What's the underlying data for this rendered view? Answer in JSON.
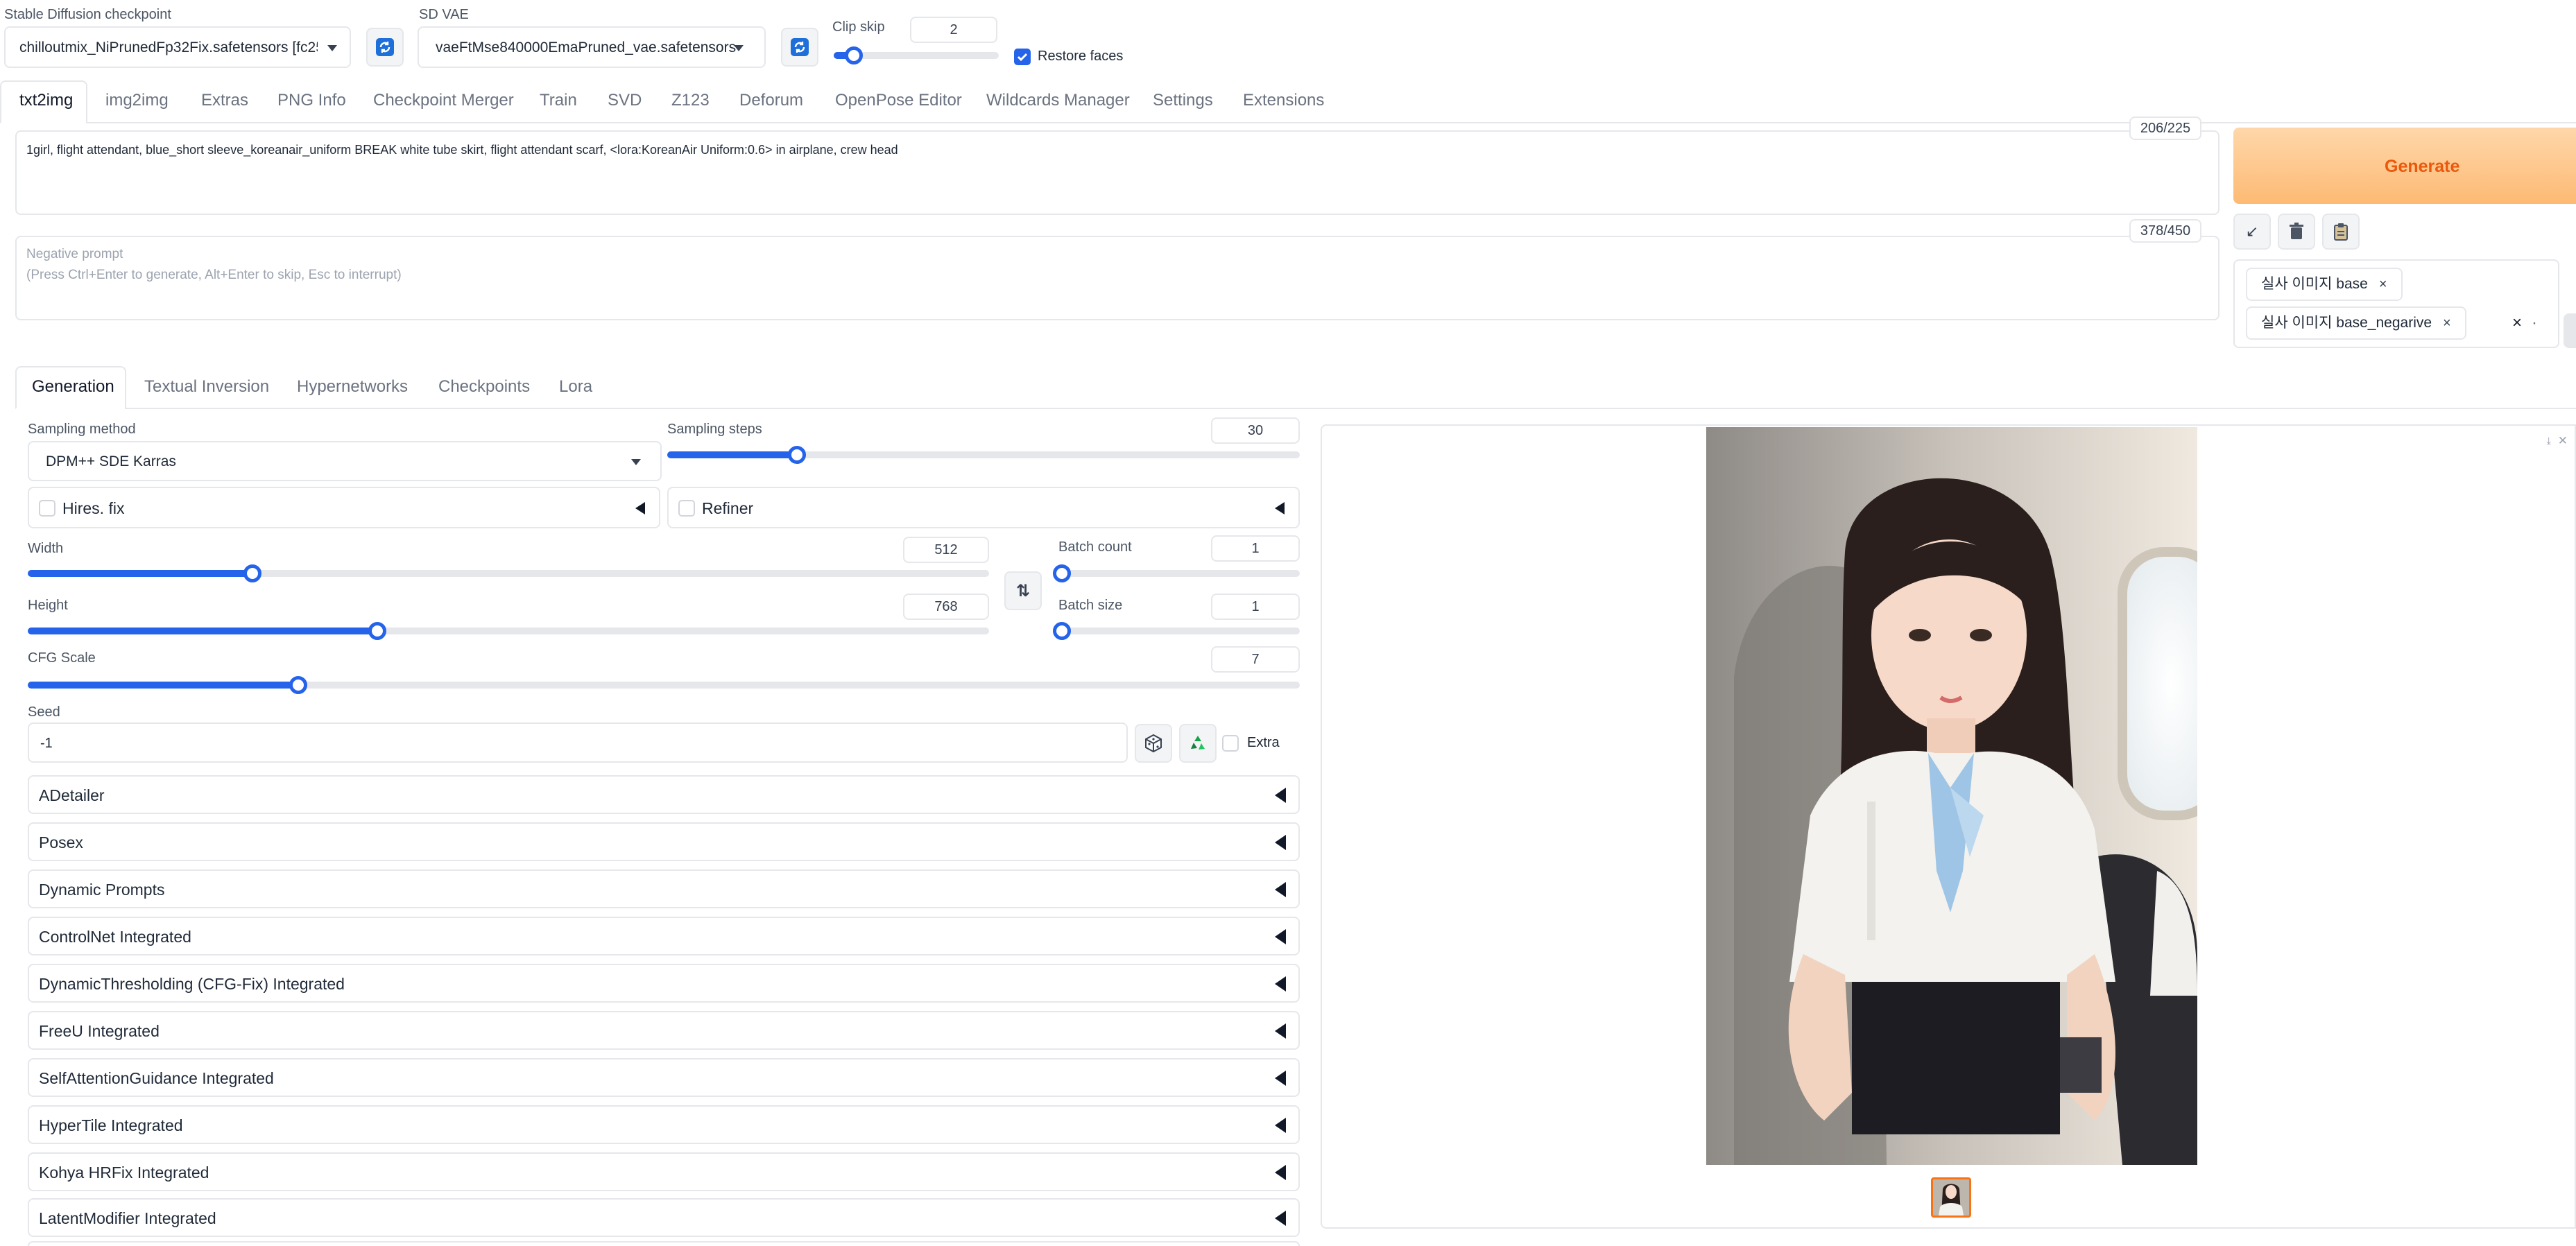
{
  "header": {
    "checkpoint_label": "Stable Diffusion checkpoint",
    "checkpoint_value": "chilloutmix_NiPrunedFp32Fix.safetensors [fc25",
    "vae_label": "SD VAE",
    "vae_value": "vaeFtMse840000EmaPruned_vae.safetensors",
    "clip_skip_label": "Clip skip",
    "clip_skip_value": "2",
    "clip_skip_fraction": 0.1,
    "restore_faces_label": "Restore faces",
    "restore_faces_checked": true
  },
  "main_tabs": [
    "txt2img",
    "img2img",
    "Extras",
    "PNG Info",
    "Checkpoint Merger",
    "Train",
    "SVD",
    "Z123",
    "Deforum",
    "OpenPose Editor",
    "Wildcards Manager",
    "Settings",
    "Extensions"
  ],
  "prompt": {
    "text": "1girl, flight attendant, blue_short sleeve_koreanair_uniform BREAK white tube skirt, flight attendant scarf, <lora:KoreanAir Uniform:0.6> in airplane, crew head",
    "counter": "206/225"
  },
  "negative": {
    "placeholder_line1": "Negative prompt",
    "placeholder_line2": "(Press Ctrl+Enter to generate, Alt+Enter to skip, Esc to interrupt)",
    "counter": "378/450"
  },
  "generate_label": "Generate",
  "styles": {
    "chip1": "실사 이미지 base",
    "chip2": "실사 이미지 base_negarive",
    "remove": "×",
    "clear": "×",
    "dropdown": "·"
  },
  "sub_tabs": [
    "Generation",
    "Textual Inversion",
    "Hypernetworks",
    "Checkpoints",
    "Lora"
  ],
  "gen": {
    "sampling_method_label": "Sampling method",
    "sampling_method_value": "DPM++ SDE Karras",
    "sampling_steps_label": "Sampling steps",
    "sampling_steps_value": "30",
    "sampling_steps_fraction": 0.2,
    "hires_label": "Hires. fix",
    "refiner_label": "Refiner",
    "width_label": "Width",
    "width_value": "512",
    "width_fraction": 0.23,
    "height_label": "Height",
    "height_value": "768",
    "height_fraction": 0.36,
    "batch_count_label": "Batch count",
    "batch_count_value": "1",
    "batch_size_label": "Batch size",
    "batch_size_value": "1",
    "cfg_label": "CFG Scale",
    "cfg_value": "7",
    "cfg_fraction": 0.21,
    "seed_label": "Seed",
    "seed_value": "-1",
    "extra_label": "Extra"
  },
  "accordions": [
    "ADetailer",
    "Posex",
    "Dynamic Prompts",
    "ControlNet Integrated",
    "DynamicThresholding (CFG-Fix) Integrated",
    "FreeU Integrated",
    "SelfAttentionGuidance Integrated",
    "HyperTile Integrated",
    "Kohya HRFix Integrated",
    "LatentModifier Integrated"
  ],
  "colors": {
    "accent": "#2563eb",
    "generate_text": "#ea580c",
    "generate_bg": "#fed7aa",
    "thumb_border": "#f97316"
  }
}
